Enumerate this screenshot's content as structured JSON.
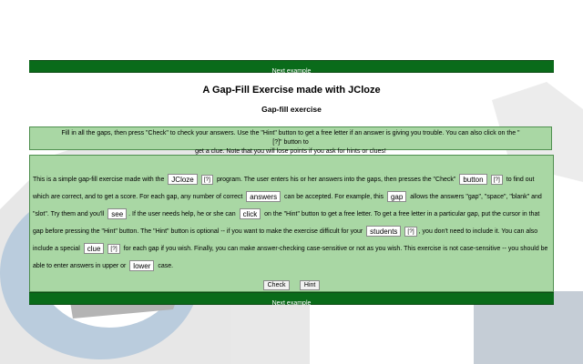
{
  "nav": {
    "next_label": "Next example"
  },
  "page_title": "A Gap-Fill Exercise made with JCloze",
  "subtitle": "Gap-fill exercise",
  "instructions": {
    "line1": "Fill in all the gaps, then press \"Check\" to check your answers. Use the \"Hint\" button to get a free letter if an answer is giving you trouble. You can also click on the \"[?]\" button to",
    "line2": "get a clue. Note that you will lose points if you ask for hints or clues!"
  },
  "exercise": {
    "t1": "This is a simple gap-fill exercise made with the",
    "g1": "JCloze",
    "t2": "program. The user enters his or her answers into the gaps, then presses the \"Check\"",
    "g2": "button",
    "t3": "to find out which are correct, and to get a score. For each gap, any number of correct",
    "g3": "answers",
    "t4": "can be accepted. For example, this",
    "g4": "gap",
    "t5": "allows the answers \"gap\", \"space\", \"blank\" and \"slot\". Try them and you'll",
    "g5": "see",
    "t6": ". If the user needs help, he or she can",
    "g6": "click",
    "t7": "on the \"Hint\" button to get a free letter. To get a free letter in a particular gap, put the cursor in that gap before pressing the \"Hint\" button. The \"Hint\" button is optional -- if you want to make the exercise difficult for your",
    "g7": "students",
    "t8": ", you don't need to include it. You can also include a special",
    "g8": "clue",
    "t9": "for each gap if you wish. Finally, you can make answer-checking case-sensitive or not as you wish. This exercise is not case-sensitive -- you should be able to enter answers in upper or",
    "g9": "lower",
    "t10": "case."
  },
  "hint_label": "[?]",
  "buttons": {
    "check": "Check",
    "hint": "Hint"
  },
  "colors": {
    "nav_green": "#0a6b1a",
    "panel_green": "#a9d7a4",
    "panel_border": "#4f8f4f"
  }
}
